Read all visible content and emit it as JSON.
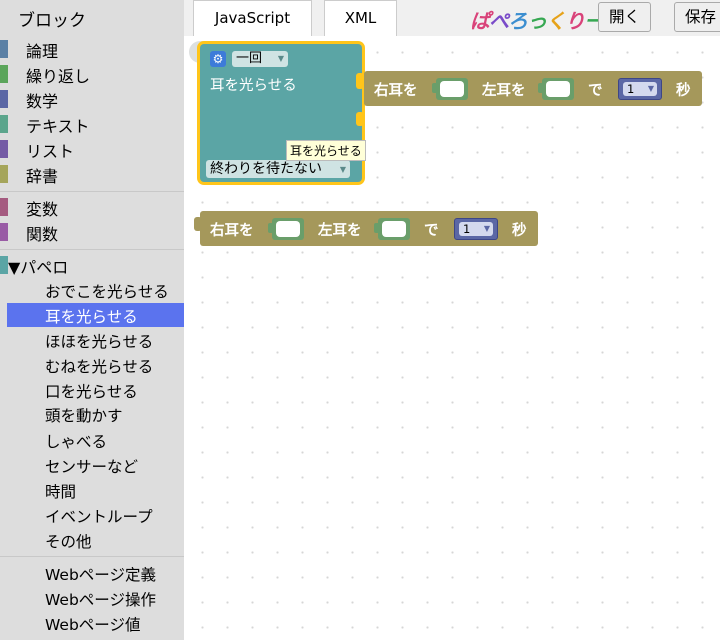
{
  "sidebar": {
    "header": "ブロック",
    "categories": [
      {
        "label": "論理",
        "color": "#5b80a5"
      },
      {
        "label": "繰り返し",
        "color": "#5ba55b"
      },
      {
        "label": "数学",
        "color": "#5b67a5"
      },
      {
        "label": "テキスト",
        "color": "#5ba58c"
      },
      {
        "label": "リスト",
        "color": "#745ba5"
      },
      {
        "label": "辞書",
        "color": "#a5a55b"
      },
      {
        "label": "変数",
        "color": "#a55b80"
      },
      {
        "label": "関数",
        "color": "#995ba5"
      }
    ],
    "papero": {
      "label": "▼パペロ",
      "color": "#5ba5a5"
    },
    "papero_items": [
      "おでこを光らせる",
      "耳を光らせる",
      "ほほを光らせる",
      "むねを光らせる",
      "口を光らせる",
      "頭を動かす",
      "しゃべる",
      "センサーなど",
      "時間",
      "イベントループ",
      "その他"
    ],
    "selected_item": "耳を光らせる",
    "web_items": [
      "Webページ定義",
      "Webページ操作",
      "Webページ値"
    ]
  },
  "topbar": {
    "tabs": [
      "JavaScript",
      "XML"
    ],
    "logo": {
      "p1": "ぱ",
      "p2": "ぺ",
      "p3": "ろ",
      "p4": "っ",
      "p5": "く",
      "p6": "り",
      "p7": "ー!"
    },
    "open_label": "開く",
    "save_label": "保存"
  },
  "workspace": {
    "block1": {
      "mode_dropdown": "一回",
      "title": "耳を光らせる",
      "wait_dropdown": "終わりを待たない",
      "tooltip": "耳を光らせる",
      "stmt": {
        "right_label": "右耳を",
        "left_label": "左耳を",
        "de_label": "で",
        "seconds": "1",
        "unit": "秒"
      }
    },
    "block2": {
      "right_label": "右耳を",
      "left_label": "左耳を",
      "de_label": "で",
      "seconds": "1",
      "unit": "秒"
    }
  },
  "colors": {
    "teal": "#5ba5a5",
    "gold": "#a5985b",
    "selected": "#5b73ee",
    "highlight": "#ffc51a"
  }
}
